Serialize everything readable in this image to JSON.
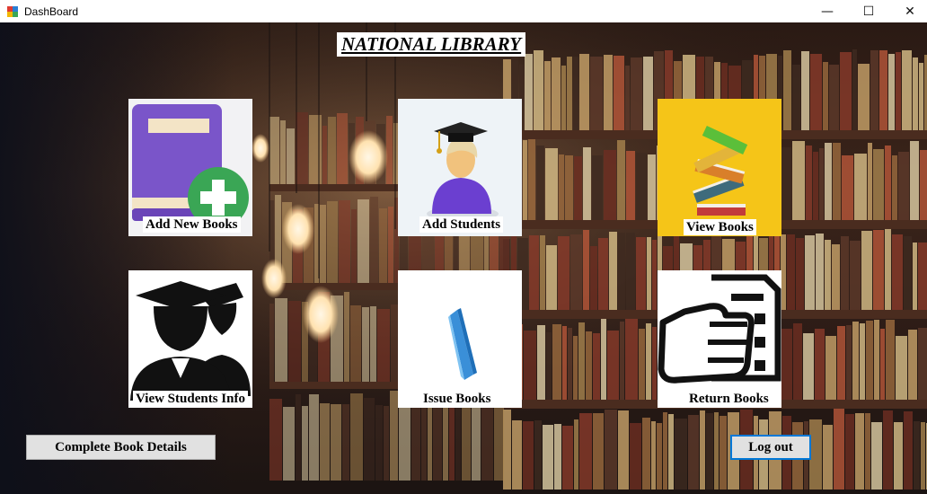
{
  "window": {
    "title": "DashBoard",
    "controls": {
      "minimize": "—",
      "maximize": "☐",
      "close": "✕"
    }
  },
  "heading": "NATIONAL LIBRARY",
  "tiles": [
    {
      "label": "Add New Books",
      "icon": "purple-book-plus-icon"
    },
    {
      "label": "Add Students",
      "icon": "graduate-student-icon"
    },
    {
      "label": "View Books",
      "icon": "book-stack-icon"
    },
    {
      "label": "View Students Info",
      "icon": "students-graduates-icon"
    },
    {
      "label": "Issue Books",
      "icon": "blue-book-icon"
    },
    {
      "label": "Return Books",
      "icon": "hand-return-document-icon"
    }
  ],
  "buttons": {
    "complete_details": "Complete Book Details",
    "logout": "Log out"
  },
  "colors": {
    "book_purple": "#7a55c9",
    "plus_green": "#3aa655",
    "yellow_bg": "#f5c518",
    "focus_blue": "#0078d7"
  }
}
